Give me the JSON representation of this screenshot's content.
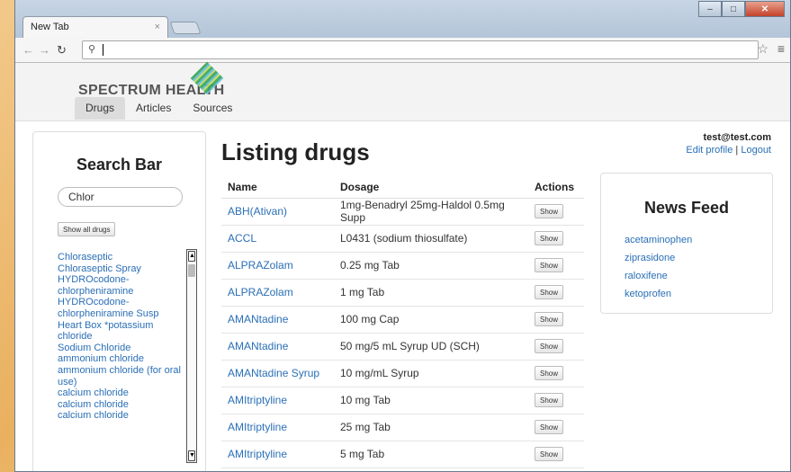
{
  "browser": {
    "tab_title": "New Tab",
    "tab_close": "×",
    "omnibox_value": ""
  },
  "site": {
    "logo_text": "SPECTRUM HEALTH",
    "nav": [
      {
        "label": "Drugs"
      },
      {
        "label": "Articles"
      },
      {
        "label": "Sources"
      }
    ]
  },
  "user": {
    "email": "test@test.com",
    "edit_profile": "Edit profile",
    "separator": "|",
    "logout": "Logout"
  },
  "sidebar": {
    "title": "Search Bar",
    "search_value": "Chlor",
    "show_all_label": "Show all drugs",
    "results": [
      "Chloraseptic",
      "Chloraseptic Spray",
      "HYDROcodone-chlorpheniramine",
      "HYDROcodone-chlorpheniramine Susp",
      "Heart Box *potassium chloride",
      "Sodium Chloride",
      "ammonium chloride",
      "ammonium chloride (for oral use)",
      "calcium chloride",
      "calcium chloride",
      "calcium chloride"
    ]
  },
  "main": {
    "title": "Listing drugs",
    "columns": [
      "Name",
      "Dosage",
      "Actions"
    ],
    "show_label": "Show",
    "rows": [
      {
        "name": "ABH(Ativan)",
        "dosage": "1mg-Benadryl 25mg-Haldol 0.5mg Supp"
      },
      {
        "name": "ACCL",
        "dosage": "L0431 (sodium thiosulfate)"
      },
      {
        "name": "ALPRAZolam",
        "dosage": "0.25 mg Tab"
      },
      {
        "name": "ALPRAZolam",
        "dosage": "1 mg Tab"
      },
      {
        "name": "AMANtadine",
        "dosage": "100 mg Cap"
      },
      {
        "name": "AMANtadine",
        "dosage": "50 mg/5 mL Syrup UD (SCH)"
      },
      {
        "name": "AMANtadine Syrup",
        "dosage": "10 mg/mL Syrup"
      },
      {
        "name": "AMItriptyline",
        "dosage": "10 mg Tab"
      },
      {
        "name": "AMItriptyline",
        "dosage": "25 mg Tab"
      },
      {
        "name": "AMItriptyline",
        "dosage": "5 mg Tab"
      }
    ]
  },
  "news": {
    "title": "News Feed",
    "items": [
      "acetaminophen",
      "ziprasidone",
      "raloxifene",
      "ketoprofen"
    ]
  }
}
